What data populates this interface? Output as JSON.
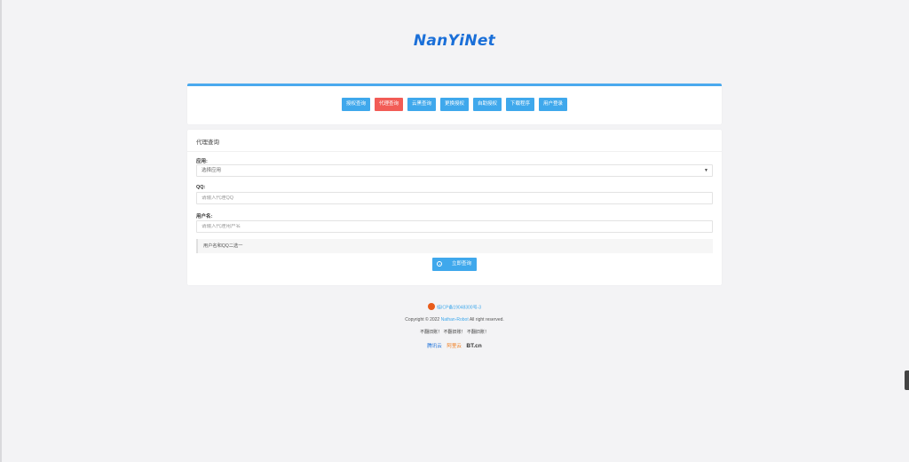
{
  "logo": "NanYiNet",
  "nav": [
    {
      "label": "授权查询",
      "active": false
    },
    {
      "label": "代理查询",
      "active": true
    },
    {
      "label": "云黑查询",
      "active": false
    },
    {
      "label": "更换授权",
      "active": false
    },
    {
      "label": "自助授权",
      "active": false
    },
    {
      "label": "下载程序",
      "active": false
    },
    {
      "label": "用户登录",
      "active": false
    }
  ],
  "colors": {
    "accent": "#3fa8ec",
    "active": "#f25c56",
    "logo": "#1a6fd8"
  },
  "form": {
    "title": "代理查询",
    "app_label": "应用:",
    "app_selected": "选择应用",
    "qq_label": "QQ:",
    "qq_placeholder": "请输入代理QQ",
    "user_label": "用户名:",
    "user_placeholder": "请输入代理用户名",
    "notice": "用户名和QQ二选一",
    "submit": "立即查询",
    "submit_icon": "search-icon"
  },
  "footer": {
    "beian": "桂ICP备19048300号-3",
    "copyright_prefix": "Copyright © 2022",
    "copyright_link": "Nathan-Robot",
    "copyright_suffix": "All right reserved.",
    "noforget": "不翻旧账！ 不翻旧账！ 不翻旧账！",
    "sponsors": {
      "tencent": "腾讯云",
      "aliyun": "阿里云",
      "bt": "BT.cn"
    }
  }
}
